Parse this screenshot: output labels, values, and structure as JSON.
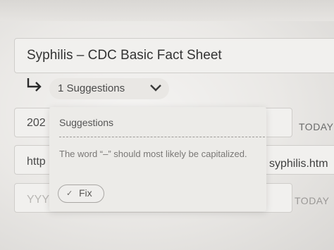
{
  "document": {
    "title": "Syphilis – CDC Basic Fact Sheet"
  },
  "suggestions_toggle": {
    "label": "1 Suggestions",
    "icon": "chevron-down-icon"
  },
  "rows": [
    {
      "value": "202",
      "right": "TODAY"
    },
    {
      "value": "http",
      "right": "syphilis.htm"
    },
    {
      "placeholder": "YYY",
      "right": "TODAY"
    }
  ],
  "popover": {
    "title": "Suggestions",
    "message": "The word “–” should most likely be capitalized.",
    "fix_label": "Fix",
    "fix_icon": "check-icon"
  }
}
